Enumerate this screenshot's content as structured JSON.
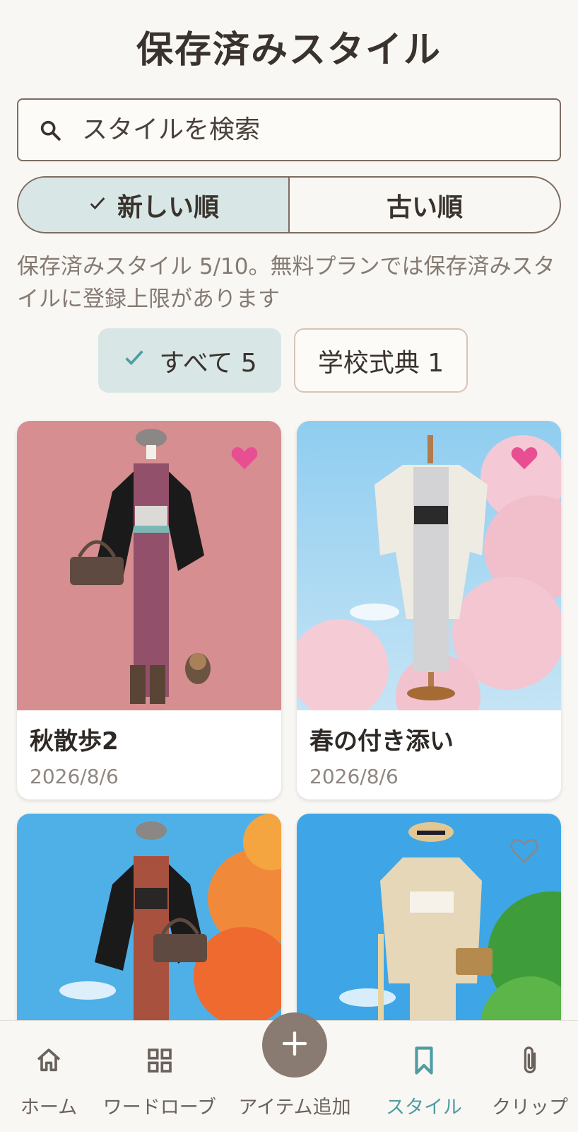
{
  "header": {
    "title": "保存済みスタイル"
  },
  "search": {
    "placeholder": "スタイルを検索"
  },
  "sort": {
    "newest_label": "新しい順",
    "oldest_label": "古い順",
    "active": "newest"
  },
  "info": {
    "text": "保存済みスタイル 5/10。無料プランでは保存済みスタイルに登録上限があります"
  },
  "filters": [
    {
      "label": "すべて 5",
      "selected": true
    },
    {
      "label": "学校式典 1",
      "selected": false
    }
  ],
  "styles": [
    {
      "title": "秋散歩2",
      "date": "2026/8/6",
      "favorite": true,
      "background": "solid-rose"
    },
    {
      "title": "春の付き添い",
      "date": "2026/8/6",
      "favorite": true,
      "background": "cherry-blossom"
    },
    {
      "title": "",
      "date": "",
      "favorite": false,
      "background": "autumn-maple"
    },
    {
      "title": "",
      "date": "",
      "favorite": false,
      "background": "summer-leaves"
    }
  ],
  "nav": [
    {
      "label": "ホーム",
      "icon": "home-icon"
    },
    {
      "label": "ワードローブ",
      "icon": "grid-icon"
    },
    {
      "label": "アイテム追加",
      "icon": "plus-icon"
    },
    {
      "label": "スタイル",
      "icon": "bookmark-icon",
      "active": true
    },
    {
      "label": "クリップ",
      "icon": "paperclip-icon"
    }
  ],
  "colors": {
    "background": "#f9f7f3",
    "accent": "#4f9da3",
    "selected_bg": "#d8e6e6",
    "heart": "#e84f93",
    "fab": "#8a7b72"
  }
}
